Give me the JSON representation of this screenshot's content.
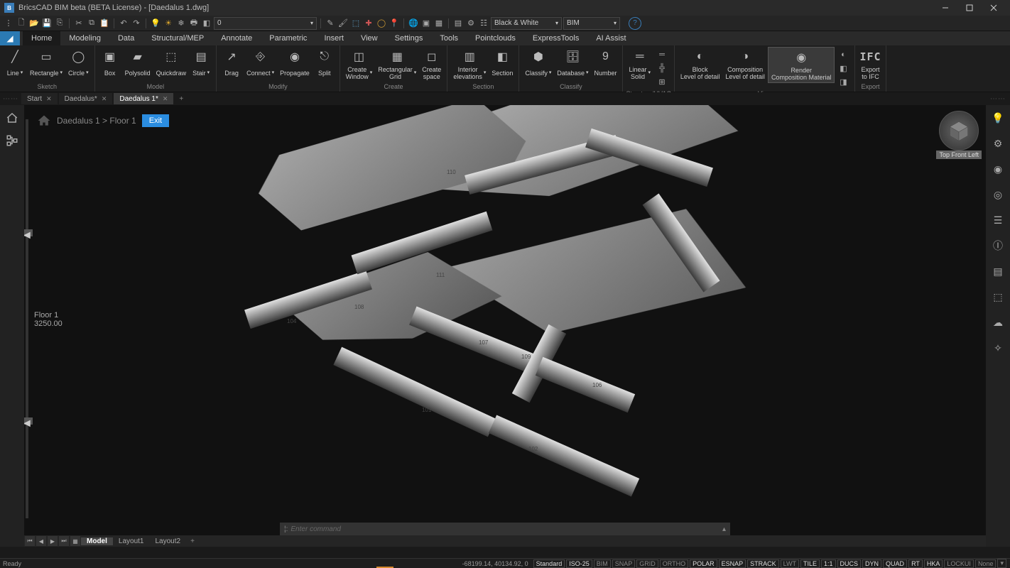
{
  "titlebar": {
    "title": "BricsCAD BIM beta (BETA License) - [Daedalus 1.dwg]"
  },
  "qat": {
    "layer_dd": "0",
    "style_dd": "Black & White",
    "workspace_dd": "BIM"
  },
  "menus": {
    "items": [
      "Home",
      "Modeling",
      "Data",
      "Structural/MEP",
      "Annotate",
      "Parametric",
      "Insert",
      "View",
      "Settings",
      "Tools",
      "Pointclouds",
      "ExpressTools",
      "AI Assist"
    ],
    "active": 0
  },
  "ribbon": {
    "groups": [
      {
        "label": "Sketch",
        "tools": [
          {
            "name": "Line",
            "drop": true
          },
          {
            "name": "Rectangle",
            "drop": true
          },
          {
            "name": "Circle",
            "drop": true
          }
        ]
      },
      {
        "label": "Model",
        "tools": [
          {
            "name": "Box"
          },
          {
            "name": "Polysolid"
          },
          {
            "name": "Quickdraw"
          },
          {
            "name": "Stair",
            "drop": true
          }
        ]
      },
      {
        "label": "Modify",
        "tools": [
          {
            "name": "Drag"
          },
          {
            "name": "Connect",
            "drop": true
          },
          {
            "name": "Propagate"
          },
          {
            "name": "Split"
          }
        ]
      },
      {
        "label": "Create",
        "tools": [
          {
            "name": "Create Window",
            "drop": true
          },
          {
            "name": "Rectangular Grid",
            "drop": true
          },
          {
            "name": "Create space"
          }
        ]
      },
      {
        "label": "Section",
        "tools": [
          {
            "name": "Interior elevations",
            "drop": true
          },
          {
            "name": "Section"
          }
        ]
      },
      {
        "label": "Classify",
        "tools": [
          {
            "name": "Classify",
            "drop": true
          },
          {
            "name": "Database",
            "drop": true
          },
          {
            "name": "Number"
          }
        ]
      },
      {
        "label": "Structure/HVAC",
        "tools": [
          {
            "name": "Linear Solid",
            "drop": true
          }
        ]
      },
      {
        "label": "View",
        "tools": [
          {
            "name": "Block Level of detail"
          },
          {
            "name": "Composition Level of detail"
          },
          {
            "name": "Render Composition Material",
            "active": true
          }
        ]
      },
      {
        "label": "Export",
        "tools": [
          {
            "name": "Export to IFC"
          }
        ]
      }
    ]
  },
  "doctabs": {
    "tabs": [
      {
        "name": "Start"
      },
      {
        "name": "Daedalus*"
      },
      {
        "name": "Daedalus 1*",
        "active": true
      }
    ]
  },
  "viewport": {
    "breadcrumb_home": "Daedalus 1 > Floor 1",
    "exit": "Exit",
    "viewcube_label": "Top Front Left",
    "floor_name": "Floor 1",
    "floor_height": "3250.00",
    "rooms": [
      "104",
      "108",
      "110",
      "111",
      "107",
      "109",
      "106",
      "101",
      "102"
    ]
  },
  "cmd": {
    "placeholder": "Enter command"
  },
  "layouttabs": {
    "tabs": [
      "Model",
      "Layout1",
      "Layout2"
    ],
    "active": 0
  },
  "status": {
    "ready": "Ready",
    "coords": "-68199.14, 40134.92, 0",
    "units": "Standard",
    "iso": "ISO-25",
    "toggles": [
      "BIM",
      "SNAP",
      "GRID",
      "ORTHO",
      "POLAR",
      "ESNAP",
      "STRACK",
      "LWT",
      "TILE",
      "1:1",
      "DUCS",
      "DYN",
      "QUAD",
      "RT",
      "HKA",
      "LOCKUI"
    ],
    "on": [
      "POLAR",
      "ESNAP",
      "STRACK",
      "TILE",
      "1:1",
      "DUCS",
      "DYN",
      "QUAD",
      "RT",
      "HKA"
    ],
    "cur": "None"
  }
}
